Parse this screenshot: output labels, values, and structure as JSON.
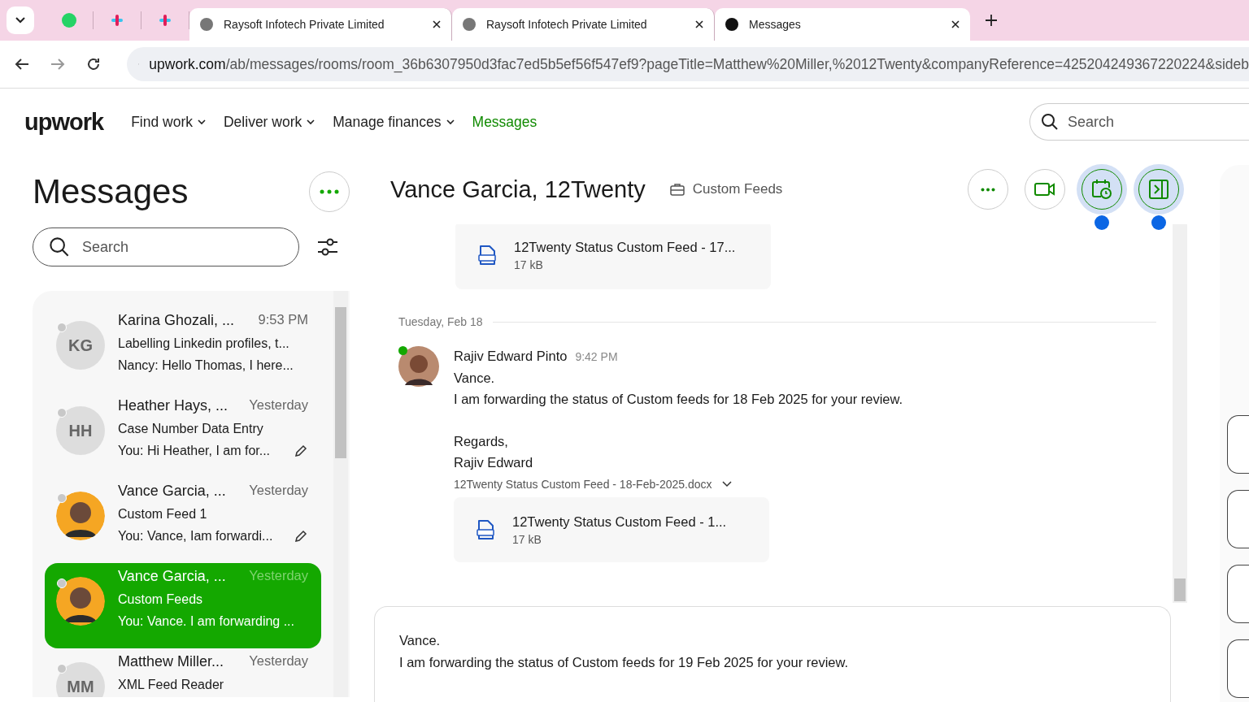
{
  "browser": {
    "tabs": [
      {
        "kind": "pinned",
        "selected": false
      },
      {
        "kind": "pinned",
        "selected": false
      },
      {
        "kind": "pinned",
        "selected": false
      },
      {
        "kind": "page",
        "title": "Raysoft Infotech Private Limited",
        "selected": false
      },
      {
        "kind": "page",
        "title": "Raysoft Infotech Private Limited",
        "selected": false
      },
      {
        "kind": "page",
        "title": "Messages",
        "selected": true
      }
    ],
    "url": {
      "host": "upwork.com",
      "path": "/ab/messages/rooms/room_36b6307950d3fac7ed5b5ef56f547ef9?pageTitle=Matthew%20Miller,%2012Twenty&companyReference=425204249367220224&sideb"
    }
  },
  "nav": {
    "logo": "upwork",
    "items": [
      {
        "label": "Find work",
        "dropdown": true,
        "selected": false
      },
      {
        "label": "Deliver work",
        "dropdown": true,
        "selected": false
      },
      {
        "label": "Manage finances",
        "dropdown": true,
        "selected": false
      },
      {
        "label": "Messages",
        "dropdown": false,
        "selected": true
      }
    ],
    "search": {
      "placeholder": "Search"
    }
  },
  "sidebar": {
    "title": "Messages",
    "search": {
      "placeholder": "Search"
    },
    "conversations": [
      {
        "initials": "KG",
        "name": "Karina Ghozali, ...",
        "time": "9:53 PM",
        "subject": "Labelling Linkedin profiles, t...",
        "preview": "Nancy: Hello Thomas, I here...",
        "draft": false,
        "selected": false
      },
      {
        "initials": "HH",
        "name": "Heather Hays, ...",
        "time": "Yesterday",
        "subject": "Case Number Data Entry",
        "preview": "You: Hi Heather, I am for...",
        "draft": true,
        "selected": false
      },
      {
        "name": "Vance Garcia, ...",
        "time": "Yesterday",
        "subject": "Custom Feed 1",
        "preview": "You: Vance, Iam forwardi...",
        "draft": true,
        "selected": false
      },
      {
        "name": "Vance Garcia, ...",
        "time": "Yesterday",
        "subject": "Custom Feeds",
        "preview": "You: Vance. I am forwarding ...",
        "draft": false,
        "selected": true
      },
      {
        "initials": "MM",
        "name": "Matthew Miller...",
        "time": "Yesterday",
        "subject": "XML Feed Reader",
        "selected": false
      }
    ]
  },
  "chat": {
    "title": "Vance Garcia, 12Twenty",
    "room": "Custom Feeds",
    "actions": [
      {
        "kind": "more",
        "highlighted": false,
        "badge": false
      },
      {
        "kind": "video",
        "highlighted": false,
        "badge": false
      },
      {
        "kind": "calendar",
        "highlighted": true,
        "badge": true
      },
      {
        "kind": "panel",
        "highlighted": true,
        "badge": true
      }
    ],
    "top_attachment": {
      "name": "12Twenty Status Custom Feed - 17...",
      "size": "17 kB"
    },
    "date_divider": "Tuesday, Feb 18",
    "message": {
      "sender": "Rajiv Edward Pinto",
      "online": true,
      "time": "9:42 PM",
      "body": [
        "Vance.",
        "I am forwarding the status of Custom feeds for 18 Feb 2025 for your review."
      ],
      "signature": [
        "Regards,",
        "Rajiv Edward"
      ],
      "file_label": "12Twenty Status Custom Feed - 18-Feb-2025.docx",
      "attachment": {
        "name": "12Twenty Status Custom Feed - 1...",
        "size": "17 kB"
      }
    },
    "composer": {
      "lines": [
        "Vance.",
        "I am forwarding the status of Custom feeds for 19 Feb 2025 for your review."
      ]
    }
  }
}
